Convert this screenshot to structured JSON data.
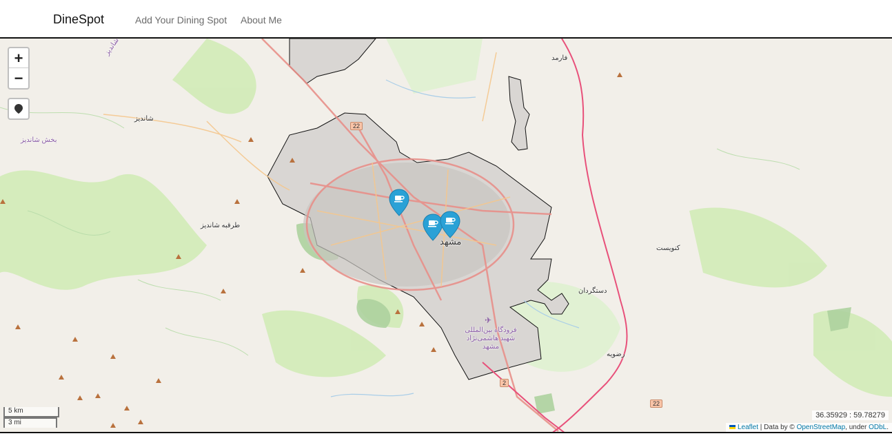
{
  "navbar": {
    "brand": "DineSpot",
    "links": [
      "Add Your Dining Spot",
      "About Me"
    ]
  },
  "map": {
    "zoom_in": "+",
    "zoom_out": "−",
    "coordinates": "36.35929 : 59.78279",
    "scale_km": "5 km",
    "scale_mi": "3 mi",
    "attribution": {
      "leaflet": "Leaflet",
      "text1": " | Data by © ",
      "osm": "OpenStreetMap",
      "text2": ", under ",
      "odbl": "ODbL",
      "text3": "."
    },
    "labels": {
      "mashhad": "مشهد",
      "shandiz": "شاندیز",
      "shandiz_district": "بخش شاندیز",
      "torqabeh": "طرقبه شاندیز",
      "torqabeh_north": "طرقبه شاندیز",
      "farmad": "فارمد",
      "konavist": "کنویست",
      "dastgerdan": "دستگردان",
      "razaviyeh": "رضویه",
      "airport": "فرودگاه بین‌المللی شهید هاشمی‌نژاد مشهد"
    },
    "road_shields": [
      "22",
      "2",
      "22"
    ],
    "colors": {
      "marker": "#2aa1d6",
      "brand": "#111111",
      "link": "#6b6b6b"
    }
  }
}
